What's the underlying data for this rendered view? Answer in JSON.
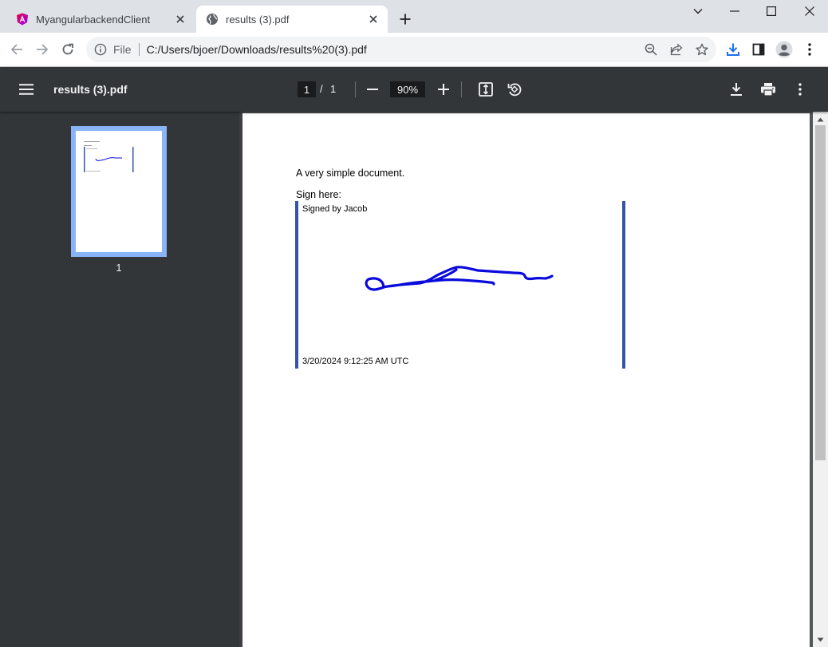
{
  "tabs": [
    {
      "title": "MyangularbackendClient",
      "favicon": "angular-icon",
      "active": false
    },
    {
      "title": "results (3).pdf",
      "favicon": "globe-icon",
      "active": true
    }
  ],
  "address_bar": {
    "scheme_label": "File",
    "url": "C:/Users/bjoer/Downloads/results%20(3).pdf"
  },
  "pdf_toolbar": {
    "doc_title": "results (3).pdf",
    "current_page": "1",
    "page_separator": "/",
    "total_pages": "1",
    "zoom": "90%"
  },
  "sidebar": {
    "thumbnails": [
      {
        "label": "1"
      }
    ]
  },
  "document": {
    "line1": "A very simple document.",
    "line2": "Sign here:",
    "signature": {
      "signed_by": "Signed by Jacob",
      "timestamp": "3/20/2024 9:12:25 AM UTC",
      "ink_color": "#0a0adc",
      "border_color": "#3355a8"
    }
  },
  "colors": {
    "download_accent": "#1a73e8",
    "thumb_highlight": "#8ab4f8",
    "pdf_toolbar_bg": "#323639"
  }
}
